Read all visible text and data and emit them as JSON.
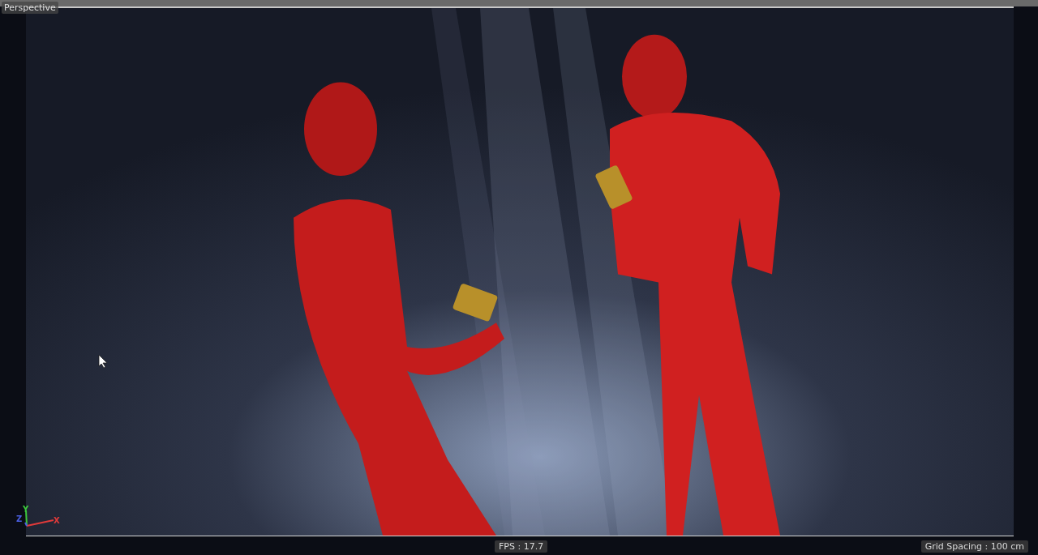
{
  "viewport": {
    "title": "Perspective",
    "picture": {
      "kind": "figure-picture"
    }
  },
  "axes": [
    {
      "label": "Y",
      "color": "#3cc83c"
    },
    {
      "label": "Z",
      "color": "#4a5ee0"
    },
    {
      "label": "X",
      "color": "#e03a3a"
    }
  ],
  "hud": {
    "fps": "FPS : 17.7",
    "grid_spacing": "Grid Spacing : 100 cm"
  }
}
